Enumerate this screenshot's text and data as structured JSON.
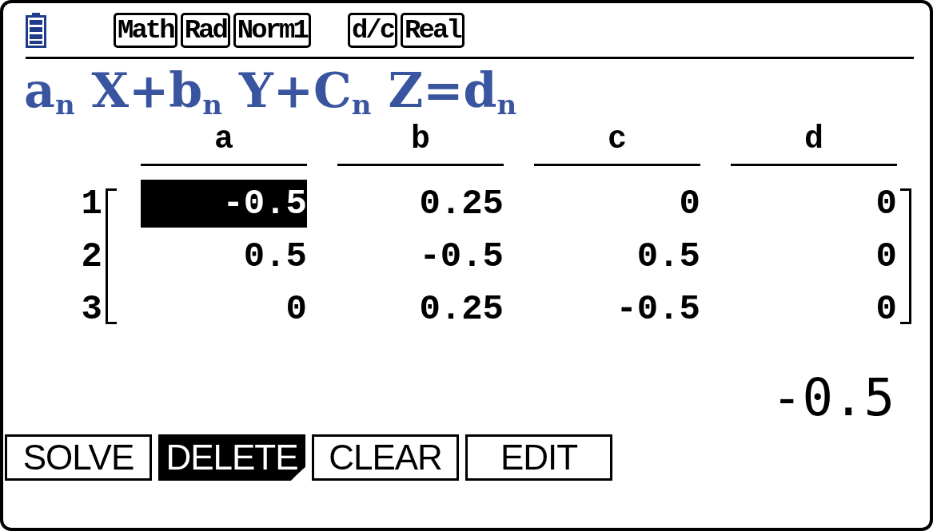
{
  "status_bar": {
    "badge_groups": [
      [
        "Math",
        "Rad",
        "Norm1"
      ],
      [
        "d/c",
        "Real"
      ]
    ]
  },
  "equation": "a$_{n}$ X+b$_{n}$ Y+C$_{n}$ Z=d$_{n}$",
  "matrix": {
    "columns": [
      "a",
      "b",
      "c",
      "d"
    ],
    "rows": [
      {
        "label": "1",
        "cells": [
          {
            "value": "-0.5",
            "selected": true
          },
          {
            "value": "0.25",
            "selected": false
          },
          {
            "value": "0",
            "selected": false
          },
          {
            "value": "0",
            "selected": false
          }
        ]
      },
      {
        "label": "2",
        "cells": [
          {
            "value": "0.5",
            "selected": false
          },
          {
            "value": "-0.5",
            "selected": false
          },
          {
            "value": "0.5",
            "selected": false
          },
          {
            "value": "0",
            "selected": false
          }
        ]
      },
      {
        "label": "3",
        "cells": [
          {
            "value": "0",
            "selected": false
          },
          {
            "value": "0.25",
            "selected": false
          },
          {
            "value": "-0.5",
            "selected": false
          },
          {
            "value": "0",
            "selected": false
          }
        ]
      }
    ]
  },
  "input": "-0.5",
  "function_keys": [
    {
      "label": "SOLVE",
      "kind": "command"
    },
    {
      "label": "DELETE",
      "kind": "submenu"
    },
    {
      "label": "CLEAR",
      "kind": "command"
    },
    {
      "label": "EDIT",
      "kind": "command"
    }
  ]
}
